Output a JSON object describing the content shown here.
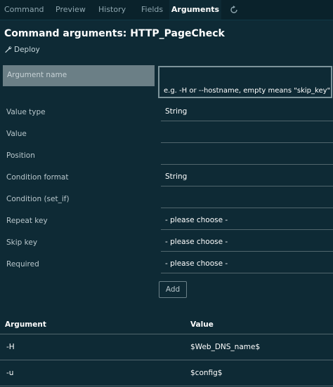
{
  "tabs": [
    {
      "label": "Command"
    },
    {
      "label": "Preview"
    },
    {
      "label": "History"
    },
    {
      "label": "Fields"
    },
    {
      "label": "Arguments"
    }
  ],
  "page": {
    "title": "Command arguments: HTTP_PageCheck",
    "deploy_label": "Deploy"
  },
  "form": {
    "argument_name": {
      "label": "Argument name",
      "value": "",
      "hint": "e.g. -H or --hostname, empty means \"skip_key\""
    },
    "rows": [
      {
        "label": "Value type",
        "value": "String"
      },
      {
        "label": "Value",
        "value": ""
      },
      {
        "label": "Position",
        "value": ""
      },
      {
        "label": "Condition format",
        "value": "String"
      },
      {
        "label": "Condition (set_if)",
        "value": ""
      },
      {
        "label": "Repeat key",
        "value": "- please choose -"
      },
      {
        "label": "Skip key",
        "value": "- please choose -"
      },
      {
        "label": "Required",
        "value": "- please choose -"
      }
    ],
    "add_label": "Add"
  },
  "table": {
    "headers": {
      "argument": "Argument",
      "value": "Value"
    },
    "rows": [
      {
        "argument": "-H",
        "value": "$Web_DNS_name$"
      },
      {
        "argument": "-u",
        "value": "$config$"
      }
    ]
  },
  "icons": {
    "refresh": "refresh-icon",
    "deploy": "wrench-icon"
  }
}
